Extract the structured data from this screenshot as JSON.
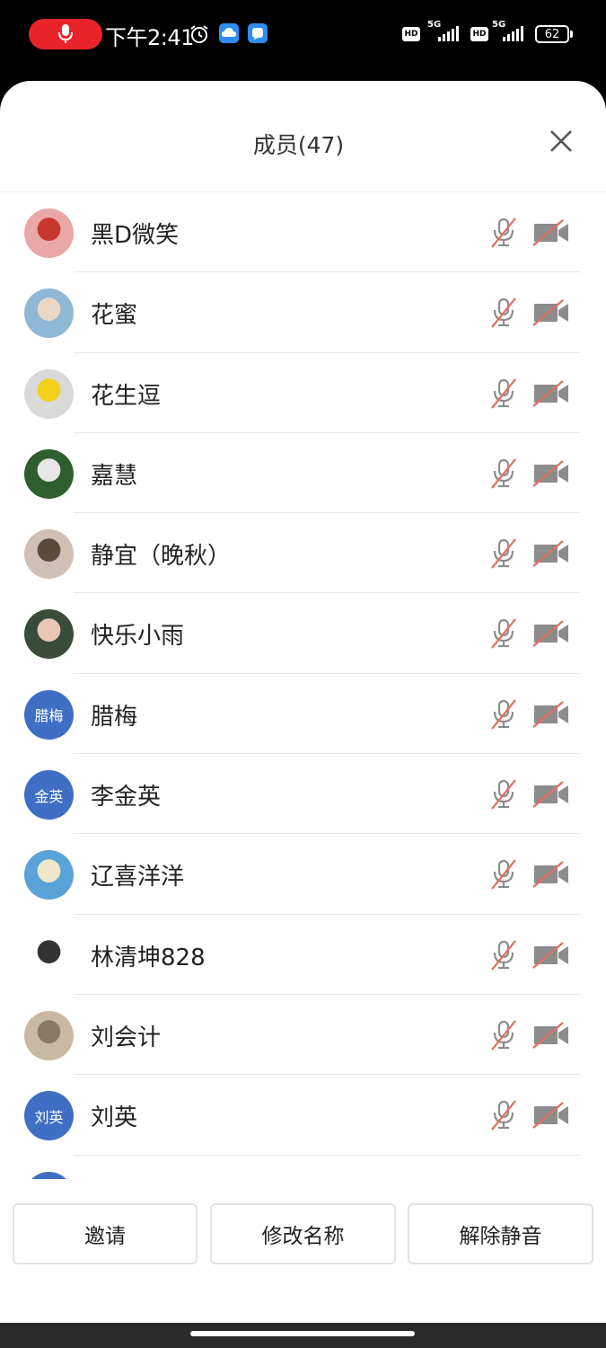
{
  "status_bar": {
    "time": "下午2:41",
    "network_1": "5G",
    "network_2": "5G",
    "hd_label": "HD",
    "battery": "62",
    "colors": {
      "recording": "#e8242a",
      "app_icon": "#2f8cf0"
    },
    "icons": [
      "microphone-icon",
      "alarm-icon",
      "cloud-icon",
      "chat-icon",
      "hd-icon",
      "signal-icon",
      "battery-icon"
    ]
  },
  "sheet": {
    "title": "成员(47)",
    "close_icon": "close-icon"
  },
  "members": [
    {
      "name": "黑D微笑",
      "avatar": "photo"
    },
    {
      "name": "花蜜",
      "avatar": "photo"
    },
    {
      "name": "花生逗",
      "avatar": "photo"
    },
    {
      "name": "嘉慧",
      "avatar": "photo"
    },
    {
      "name": "静宜（晚秋）",
      "avatar": "photo"
    },
    {
      "name": "快乐小雨",
      "avatar": "photo"
    },
    {
      "name": "腊梅",
      "avatar_text": "腊梅"
    },
    {
      "name": "李金英",
      "avatar_text": "金英"
    },
    {
      "name": "辽喜洋洋",
      "avatar": "photo"
    },
    {
      "name": "林清坤828",
      "avatar": "photo"
    },
    {
      "name": "刘会计",
      "avatar": "photo"
    },
    {
      "name": "刘英",
      "avatar_text": "刘英"
    }
  ],
  "member_icons": {
    "mic": "mic-muted-icon",
    "cam": "camera-off-icon",
    "muted_color": "#e0715f",
    "icon_color": "#8c8c8c"
  },
  "buttons": {
    "invite": "邀请",
    "rename": "修改名称",
    "unmute": "解除静音"
  }
}
